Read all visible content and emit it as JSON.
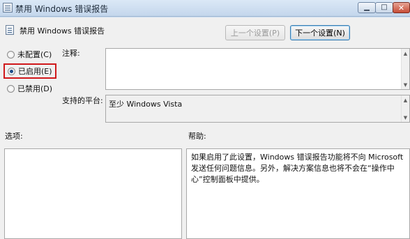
{
  "window": {
    "title": "禁用 Windows 错误报告",
    "minimize_glyph": "▁",
    "maximize_glyph": "□",
    "close_glyph": "✕"
  },
  "header": {
    "policy_name": "禁用 Windows 错误报告",
    "prev_button": "上一个设置(P)",
    "next_button": "下一个设置(N)"
  },
  "options": {
    "not_configured": "未配置(C)",
    "enabled": "已启用(E)",
    "disabled": "已禁用(D)",
    "selected": "enabled"
  },
  "comment": {
    "label": "注释:",
    "value": ""
  },
  "supported": {
    "label": "支持的平台:",
    "value": "至少 Windows Vista"
  },
  "options_section": {
    "label": "选项:"
  },
  "help": {
    "label": "帮助:",
    "text": "如果启用了此设置，Windows 错误报告功能将不向 Microsoft 发送任何问题信息。另外，解决方案信息也将不会在“操作中心”控制面板中提供。"
  },
  "colors": {
    "highlight_border": "#d0181b",
    "titlebar": "#c9dcf0"
  }
}
